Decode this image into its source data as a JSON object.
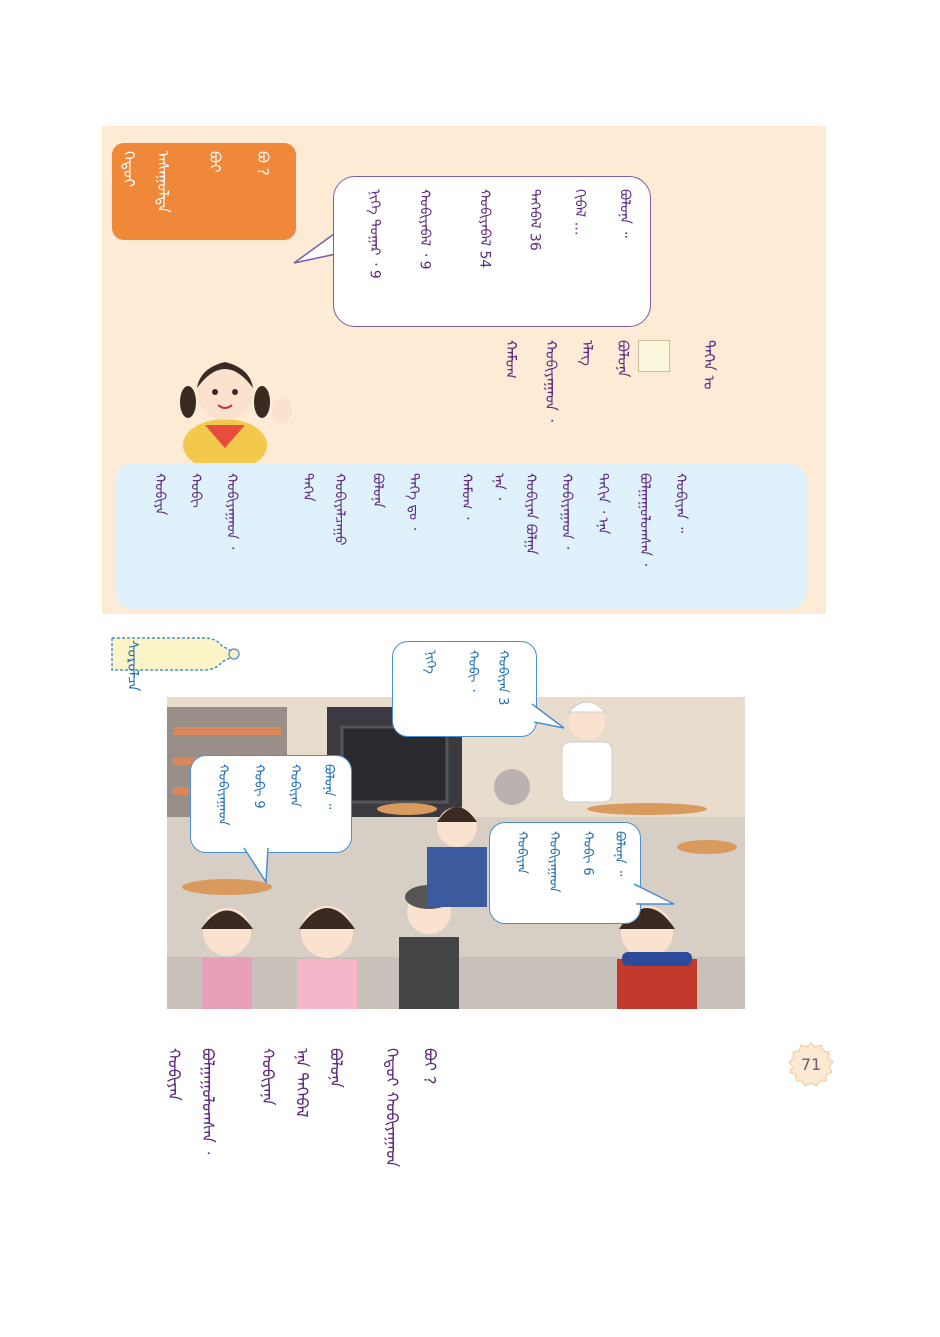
{
  "page_number": "71",
  "orange_tag": {
    "lines": [
      "ᠬᠡᠳᠦᠢ",
      "ᠠᠰᠠᠭᠤᠯᠲᠠ",
      "ᠪᠤᠢ",
      "ᠪᠤ ?"
    ]
  },
  "speech_bubble": {
    "lines": [
      "ᠪᠤᠯᠤᠨᠠ ᠃",
      "ᠬᠢᠪᠡᠯ …",
      "ᠲᠡᠭᠡᠪᠡᠯ 36",
      "ᠬᠤᠪᠢᠶᠠᠪᠠᠯ 54",
      "ᠬᠤᠪᠢᠶᠠᠪᠠᠯ ᠂ 9",
      "ᠨᠢᠭᠡ ᠳᠤᠭᠠᠷ ᠂ 9"
    ],
    "numbers": [
      "36",
      "54",
      "9",
      "9"
    ],
    "ellipsis": "…"
  },
  "question_block": {
    "lines": [
      "ᠲᠡᠭᠡᠨ ᠤ",
      "ᠪᠤᠯᠤᠨᠠ",
      "ᠡᠯᠡᠭ",
      "ᠬᠤᠪᠢᠶᠠᠭᠠᠳ ᠂",
      "ᠬᠠᠮᠤᠭ"
    ]
  },
  "info_panel": {
    "lines": [
      "ᠬᠤᠪᠢᠶᠠᠨ ᠃",
      "ᠪᠤᠯᠭᠠᠭᠤᠯᠤᠭᠰᠠᠨ ᠂",
      "ᠳᠠᠬᠢᠨ ᠂ ᠡᠨᠡ",
      "ᠬᠤᠪᠢᠶᠠᠭᠠᠳ ᠂",
      "ᠬᠤᠪᠢᠶᠠᠨ ᠪᠤᠯᠭᠠ",
      "ᠡᠨᠡ ᠂",
      "ᠬᠠᠮᠤᠭ ᠂",
      "ᠲᠡᠭᠡ ᠳᠤ ᠂",
      "ᠪᠤᠯᠤᠨᠠ",
      "ᠬᠤᠪᠢᠶᠠᠯᠴᠠᠭᠤ",
      "ᠲᠡᠭᠡᠨ",
      "ᠬᠤᠪᠢᠶᠠᠭᠠᠳ ᠂",
      "ᠬᠤᠪᠢ",
      "ᠬᠤᠪᠢᠶᠠ"
    ]
  },
  "section_label": {
    "text": "ᠰᠤᠷᠤᠯᠴᠠ"
  },
  "scene_bubbles": {
    "chef": [
      "ᠬᠤᠪᠢᠶᠠᠨ 3",
      "ᠬᠤᠪᠢ ᠂",
      "ᠨᠢᠭᠡ"
    ],
    "left": [
      "ᠪᠤᠯᠤᠨᠠ ᠃",
      "ᠬᠤᠪᠢᠶᠠᠨ",
      "ᠬᠤᠪᠢ 9",
      "ᠬᠤᠪᠢᠶᠠᠭᠠᠳ"
    ],
    "right": [
      "ᠪᠤᠯᠤᠨᠠ ᠃",
      "ᠬᠤᠪᠢ 6",
      "ᠬᠤᠪᠢᠶᠠᠭᠠᠳ",
      "ᠬᠤᠪᠢᠶᠠᠨ"
    ]
  },
  "bottom_question": {
    "lines": [
      "ᠪᠤᠢ ?",
      "ᠬᠡᠳᠦᠢ ᠬᠤᠪᠢᠶᠠᠭᠠᠳ",
      "ᠪᠤᠯᠤᠨᠠ",
      "ᠡᠨᠡ ᠲᠡᠭᠡᠪᠡᠯ",
      "ᠬᠤᠪᠢᠶᠠᠨᠠ",
      "ᠪᠤᠯᠭᠠᠭᠤᠯᠤᠭᠰᠠᠨ ᠂",
      "ᠬᠤᠪᠢᠶᠠᠨ"
    ]
  },
  "colors": {
    "panel_bg": "#fdebd6",
    "orange_tag": "#f0883a",
    "info_panel": "#dff2fb",
    "mongolian_text": "#5d2a7e",
    "bubble_text": "#1e6cb6"
  }
}
